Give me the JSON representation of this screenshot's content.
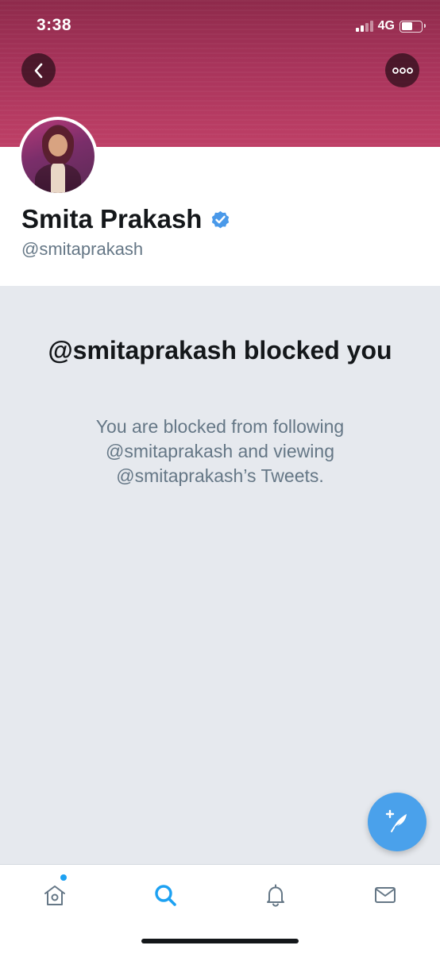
{
  "status_bar": {
    "time": "3:38",
    "network": "4G",
    "battery_level": 0.58
  },
  "header": {
    "back_icon": "chevron-left-icon",
    "more_icon": "more-horizontal-icon",
    "banner_color": "#a8345b"
  },
  "profile": {
    "display_name": "Smita Prakash",
    "verified": true,
    "verified_color": "#4a99e9",
    "handle": "@smitaprakash"
  },
  "blocked": {
    "title": "@smitaprakash blocked you",
    "description": "You are blocked from following @smitaprakash and viewing @smitaprakash’s Tweets."
  },
  "fab": {
    "icon": "compose-tweet-icon",
    "color": "#4aa1eb"
  },
  "tabbar": {
    "items": [
      {
        "name": "home",
        "icon": "home-icon",
        "active": false,
        "has_badge": true
      },
      {
        "name": "search",
        "icon": "search-icon",
        "active": true
      },
      {
        "name": "notifications",
        "icon": "bell-icon",
        "active": false
      },
      {
        "name": "messages",
        "icon": "mail-icon",
        "active": false
      }
    ],
    "active_color": "#1da1f2",
    "inactive_color": "#657786"
  }
}
